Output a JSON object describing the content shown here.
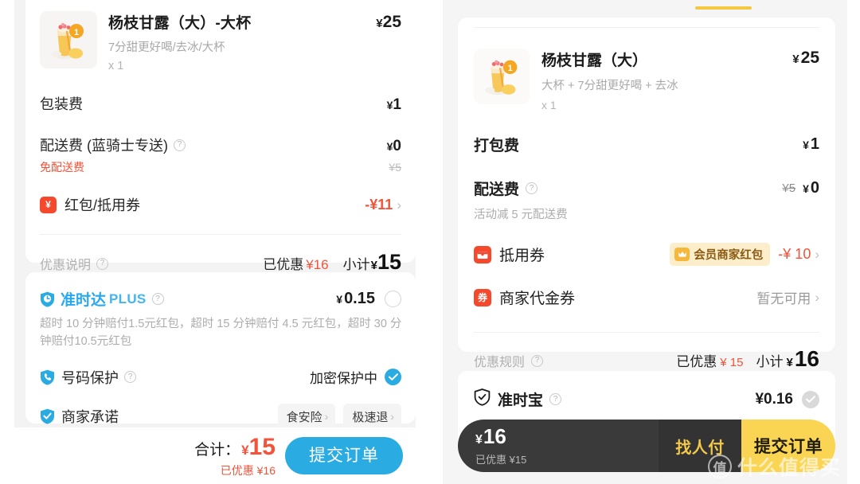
{
  "left": {
    "item": {
      "name": "杨枝甘露（大）-大杯",
      "spec": "7分甜更好喝/去冰/大杯",
      "qty": "x 1",
      "price_yen": "¥",
      "price": "25",
      "thumb_icon": "drink-thumbnail"
    },
    "fees": [
      {
        "label": "包装费",
        "yen": "¥",
        "amount": "1"
      }
    ],
    "delivery": {
      "label": "配送费 (蓝骑士专送)",
      "help_icon": "help-icon",
      "yen": "¥",
      "amount": "0",
      "note": "免配送费",
      "original": "¥5"
    },
    "coupon": {
      "badge_icon": "yen-badge-icon",
      "badge_text": "¥",
      "label": "红包/抵用券",
      "amount": "-¥11",
      "chevron": "chevron-right-icon"
    },
    "summary": {
      "note_label": "优惠说明",
      "help_icon": "help-icon",
      "discount_label": "已优惠",
      "discount_value": "¥16",
      "subtotal_label": "小计",
      "subtotal_yen": "¥",
      "subtotal_value": "15"
    },
    "plus": {
      "icon": "shield-clock-icon",
      "name": "准时达",
      "suffix": "PLUS",
      "help_icon": "help-icon",
      "yen": "¥",
      "price": "0.15",
      "radio": "radio-unchecked-icon",
      "desc": "超时 10 分钟赔付1.5元红包，超时 15 分钟赔付 4.5 元红包，超时 30 分钟赔付10.5元红包"
    },
    "phone_protect": {
      "icon": "phone-shield-icon",
      "label": "号码保护",
      "help_icon": "help-icon",
      "status": "加密保护中",
      "status_icon": "check-circle-blue-icon"
    },
    "merchant_promise": {
      "icon": "check-shield-icon",
      "label": "商家承诺",
      "tags": [
        {
          "label": "食安险",
          "chevron": "chevron-right-icon"
        },
        {
          "label": "极速退",
          "chevron": "chevron-right-icon"
        }
      ]
    },
    "bottom": {
      "total_label": "合计：",
      "total_yen": "¥",
      "total_value": "15",
      "discount_text": "已优惠 ¥16",
      "submit_label": "提交订单"
    }
  },
  "right": {
    "tab_indicator": "active-tab-underline",
    "item": {
      "name": "杨枝甘露（大）",
      "spec": "大杯 + 7分甜更好喝 + 去冰",
      "qty": "x 1",
      "price_yen": "¥",
      "price": "25",
      "thumb_icon": "drink-thumbnail"
    },
    "packing": {
      "label": "打包费",
      "yen": "¥",
      "amount": "1"
    },
    "delivery": {
      "label": "配送费",
      "help_icon": "help-icon",
      "original": "¥5",
      "yen": "¥",
      "amount": "0",
      "note": "活动减 5 元配送费"
    },
    "voucher": {
      "badge_icon": "coupon-badge-icon",
      "label": "抵用券",
      "vip_badge_icon": "crown-icon",
      "vip_badge_label": "会员商家红包",
      "amount": "-¥ 10",
      "chevron": "chevron-right-icon"
    },
    "merchant_voucher": {
      "badge_icon": "voucher-badge-icon",
      "badge_text": "券",
      "label": "商家代金券",
      "status": "暂无可用",
      "chevron": "chevron-right-icon"
    },
    "summary": {
      "rules_label": "优惠规则",
      "help_icon": "help-icon",
      "discount_label": "已优惠",
      "discount_value": "¥ 15",
      "subtotal_label": "小计",
      "subtotal_yen": "¥",
      "subtotal_value": "16"
    },
    "zhunshibao": {
      "icon": "check-shield-outline-icon",
      "label": "准时宝",
      "help_icon": "help-icon",
      "price": "¥0.16",
      "toggle_icon": "check-circle-grey-icon"
    },
    "bottom": {
      "amount_yen": "¥",
      "amount": "16",
      "discount_text": "已优惠 ¥15",
      "find_payer_label": "找人付",
      "submit_label": "提交订单"
    }
  },
  "watermark": {
    "logo_text": "值",
    "text": "什么值得买"
  },
  "colors": {
    "accent_blue": "#2aace3",
    "accent_red": "#f2533a",
    "badge_red": "#f4492d",
    "accent_yellow": "#fad453",
    "dark_bar": "#3a3a3a",
    "vip_badge_bg": "#fdeecb"
  }
}
